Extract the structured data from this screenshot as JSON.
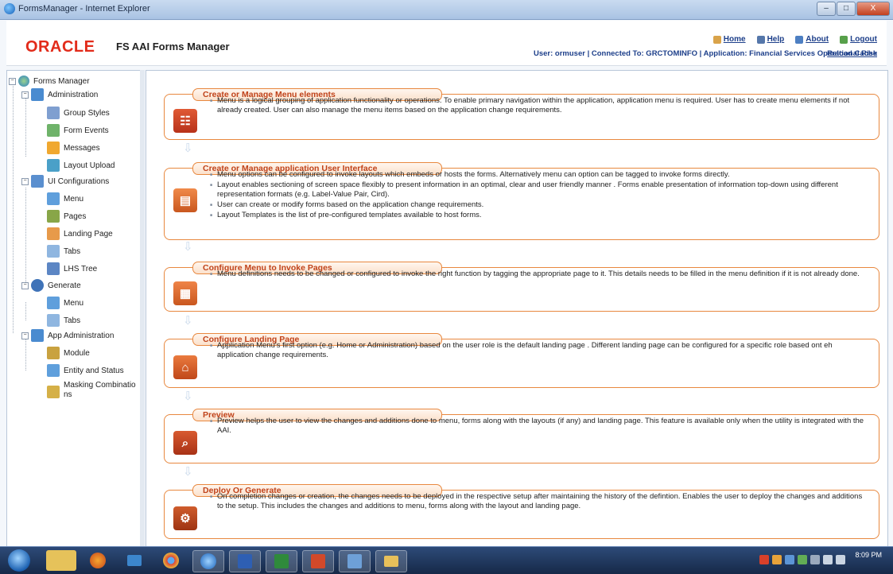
{
  "window": {
    "title": "FormsManager - Internet Explorer",
    "minimize": "–",
    "maximize": "□",
    "close": "X"
  },
  "header": {
    "logo": "ORACLE",
    "product": "FS AAI Forms Manager",
    "links": {
      "home": "Home",
      "help": "Help",
      "about": "About",
      "logout": "Logout"
    },
    "session": "User: ormuser | Connected To: GRCTOMINFO | Application: Financial Services Operational Risk",
    "reload": "Reload Cache"
  },
  "tree": {
    "root": "Forms Manager",
    "groups": [
      {
        "label": "Administration",
        "items": [
          "Group Styles",
          "Form Events",
          "Messages",
          "Layout Upload"
        ]
      },
      {
        "label": "UI Configurations",
        "items": [
          "Menu",
          "Pages",
          "Landing Page",
          "Tabs",
          "LHS Tree"
        ]
      },
      {
        "label": "Generate",
        "items": [
          "Menu",
          "Tabs"
        ]
      },
      {
        "label": "App Administration",
        "items": [
          "Module",
          "Entity and Status",
          "Masking Combinatio",
          "ns"
        ]
      }
    ]
  },
  "sections": [
    {
      "title": "Create or Manage Menu elements",
      "bullets": [
        "Menu is a logical grouping of application functionality or operations. To enable primary navigation within the application, application menu is required. User has to create menu elements if not already created. User can also manage the menu items based on the application change requirements."
      ]
    },
    {
      "title": "Create or Manage application User Interface",
      "bullets": [
        "Menu options can be configured to invoke layouts which embeds or hosts the forms. Alternatively menu can option can be tagged to invoke forms directly.",
        "Layout enables sectioning of screen space flexibly to present information in an optimal, clear and user friendly manner . Forms enable presentation of information top-down using different representation formats (e.g. Label-Value Pair, Cird).",
        "User can create or modify forms based on the application change requirements.",
        "Layout Templates is the list of pre-configured templates available to host forms."
      ]
    },
    {
      "title": "Configure Menu to Invoke Pages",
      "bullets": [
        "Menu definitions needs to be changed or configured to invoke the right function by tagging the appropriate page to it. This details needs to be filled in the menu definition if it is not already done."
      ]
    },
    {
      "title": "Configure Landing Page",
      "bullets": [
        "Application Menu's first option (e.g. Home or Administration) based on the user role is the default landing page . Different landing page can be configured for a specific role based ont eh application change requirements."
      ]
    },
    {
      "title": "Preview",
      "bullets": [
        "Preview helps the user to view the changes and additions done to menu, forms along with the layouts (if any) and landing page. This feature is available only when the utility is integrated with the AAI."
      ]
    },
    {
      "title": "Deploy Or Generate",
      "bullets": [
        "On completion changes or creation, the changes needs to be deployed in the respective setup after maintaining the history of the defintion. Enables the user to deploy the changes and additions to the setup. This includes the changes and additions to menu, forms along with the layout and landing page."
      ]
    }
  ],
  "taskbar": {
    "clock": "8:09 PM"
  },
  "colors": {
    "accent": "#e8883f",
    "title": "#c0431b",
    "oracle_red": "#e22b1a",
    "link": "#1d3f8a"
  }
}
